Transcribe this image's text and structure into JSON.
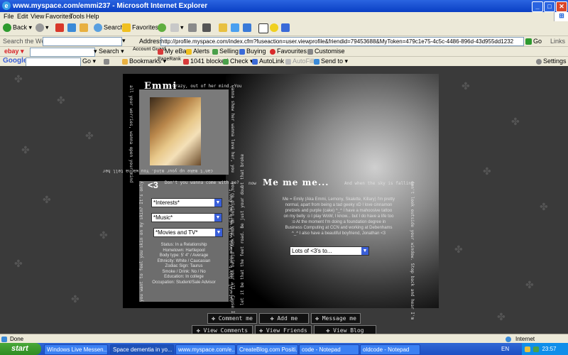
{
  "window": {
    "title": "www.myspace.com/emmi237 - Microsoft Internet Explorer"
  },
  "menu": [
    "File",
    "Edit",
    "View",
    "Favorites",
    "Tools",
    "Help"
  ],
  "toolbar": {
    "back": "Back",
    "search": "Search",
    "favorites": "Favorites"
  },
  "address": {
    "search_web_label": "Search the Web",
    "label": "Address",
    "url": "http://profile.myspace.com/index.cfm?fuseaction=user.viewprofile&friendid=79453688&MyToken=479c1e75-4c5c-4486-896d-43d955dd1232",
    "go": "Go",
    "links": "Links"
  },
  "ebay": {
    "search": "Search",
    "account_guard": "Account Guard",
    "my_ebay": "My eBay",
    "alerts": "Alerts",
    "selling": "Selling",
    "buying": "Buying",
    "favourites": "Favourites",
    "customise": "Customise"
  },
  "google": {
    "label": "Google",
    "go": "Go",
    "bookmarks": "Bookmarks",
    "pagerank": "PageRank",
    "blocked": "1041 blocked",
    "check": "Check",
    "autolink": "AutoLink",
    "autofill": "AutoFill",
    "send_to": "Send to",
    "settings": "Settings"
  },
  "profile": {
    "name": "Emmi",
    "tagline": "Crazy, out of her mind. You",
    "left_vertical": "all your worries, wanna open your mind",
    "mid_vertical": "wanna show her wanna love her, you",
    "mid_vertical2": "can't make up your mind. You wanna tell her",
    "heart": "<3",
    "dont_you_wanna": "Don't you wanna come with me?",
    "selects": [
      "*Interests*",
      "*Music*",
      "*Movies and TV*"
    ],
    "details": [
      "Status: In a Relationship",
      "Hometown: Hartlepool",
      "Body type: 5' 4\" / Average",
      "Ethnicity: White / Caucasian",
      "Zodiac Sign: Taurus",
      "Smoke / Drink: No / No",
      "Education: In college",
      "Occupation: Student/Sale Advisor"
    ],
    "bottom_vertical": "you want to feel you skin on my skin? It's only",
    "right_vertical": "you're giving up your way, giving your all. Cause I'm",
    "natural": "natural. Don't you wanna walk with me? Don't",
    "now": "now",
    "me_title": "Me me me...",
    "when_sky": "And when the sky is falling",
    "bio": "Me = Emily (Aka Emmi, Lemony, Skalette, Killary) I'm pretty normal, apart from being a tad geeky xD I love cinnamon pretzels and purple (cake) ^_^ I have a mahoosive tattoo on my belly :o I play WoW, I know... but I do have a life too :o At the moment I'm doing a foundation degree in Business Computing at CCN and working at Debenhams ^_^ I also have a beautiful boyfriend, Jonathan <3",
    "lots_select": "Lots of <3's to...",
    "right_far_vertical": "don't look outside your window. Stop back and hear I'm",
    "right_far_vertical2": "let it be that the feet road. Be just your doubt that broke",
    "links": [
      "Comment me",
      "Add me",
      "Message me",
      "View Comments",
      "View Friends",
      "View Blog"
    ]
  },
  "status": {
    "done": "Done",
    "zone": "Internet"
  },
  "taskbar": {
    "start": "start",
    "tasks": [
      "Windows Live Messen...",
      "Space dementia in yo...",
      "www.myspace.com/e...",
      "CreateBlog.com Positi...",
      "code - Notepad",
      "oldcode - Notepad"
    ],
    "lang": "EN",
    "clock": "23:57"
  }
}
